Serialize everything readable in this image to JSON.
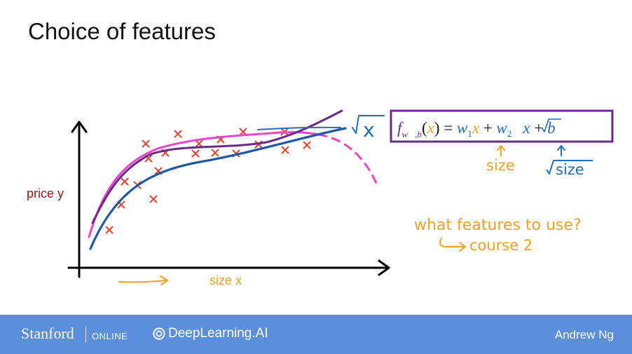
{
  "slide": {
    "title": "Choice of features"
  },
  "graph": {
    "ylabel": "price y",
    "xlabel": "size x",
    "sqrt_x_label": "x"
  },
  "formula": {
    "f": "f",
    "subscript": "w⃗,b",
    "open": "(",
    "x1": "x",
    "close": ") = ",
    "w1": "w",
    "w1_sub": "1",
    "x2": "x",
    "plus1": " + ",
    "w2": "w",
    "w2_sub": "2",
    "sqrt_x": "x",
    "plus2": " + ",
    "b": "b"
  },
  "annotations": {
    "size_label": "size",
    "sqrt_size_label": "size",
    "question": "what features to use?",
    "course_ref": "course 2"
  },
  "footer": {
    "stanford": "Stanford",
    "online": "ONLINE",
    "deeplearning": "DeepLearning.AI",
    "author": "Andrew Ng"
  },
  "colors": {
    "orange": "#f5a020",
    "blue": "#1f6fc0",
    "purple": "#6a2b8c",
    "magenta": "#ee44cc",
    "dark_blue": "#1d5aa6",
    "red_x": "#e8452c",
    "footer_bg": "#5b8fdd",
    "ylabel_red": "#a31515"
  }
}
